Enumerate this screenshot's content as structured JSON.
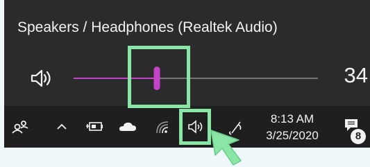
{
  "flyout": {
    "device_name": "Speakers / Headphones (Realtek Audio)",
    "volume_level": 34,
    "volume_text": "34",
    "accent_color": "#c543c9"
  },
  "taskbar": {
    "icons": [
      "people-icon",
      "chevron-up-icon",
      "battery-icon",
      "cloud-icon",
      "wifi-icon",
      "volume-icon",
      "pen-icon",
      "notification-icon"
    ],
    "clock": {
      "time": "8:13 AM",
      "date": "3/25/2020"
    },
    "notification_count": "8"
  },
  "annotations": {
    "highlight_color": "#8ae6a6",
    "pointer": "arrow-pointer-icon"
  }
}
